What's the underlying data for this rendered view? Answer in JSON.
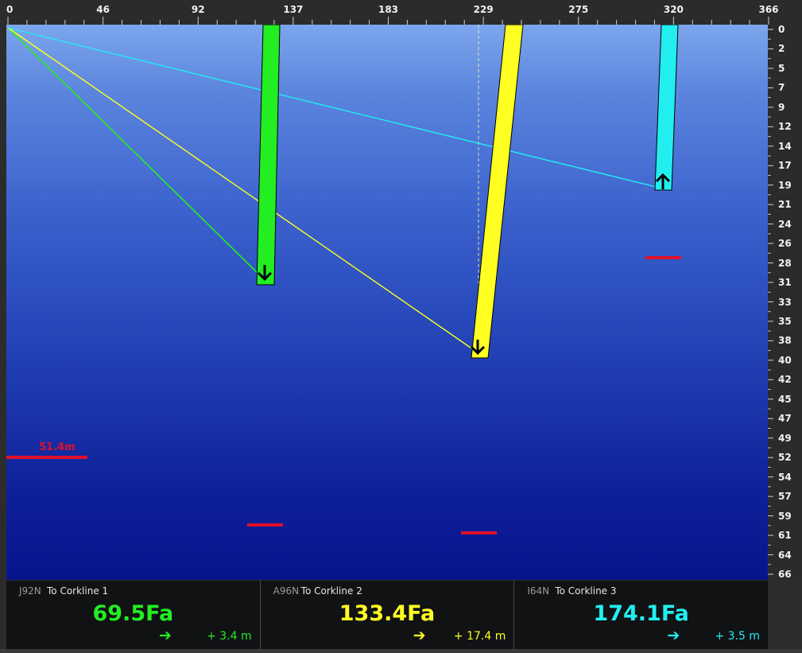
{
  "top_axis": {
    "labels": [
      "0",
      "46",
      "92",
      "137",
      "183",
      "229",
      "275",
      "320",
      "366"
    ]
  },
  "right_axis": {
    "labels": [
      "0",
      "2",
      "5",
      "7",
      "9",
      "12",
      "14",
      "17",
      "19",
      "21",
      "24",
      "26",
      "28",
      "31",
      "33",
      "35",
      "38",
      "40",
      "42",
      "45",
      "47",
      "49",
      "52",
      "54",
      "57",
      "59",
      "61",
      "64",
      "66"
    ]
  },
  "plot": {
    "depth_marker_label": "51.4m",
    "colors": {
      "green": "#22ee22",
      "yellow": "#ffff22",
      "cyan": "#22eef0",
      "marker_red": "#e0102a"
    }
  },
  "panels": [
    {
      "code": "J92N",
      "name": "To Corkline  1",
      "value": "69.5Fa",
      "arrow": "➔",
      "delta": "+ 3.4 m",
      "color": "#22ee22"
    },
    {
      "code": "A96N",
      "name": "To Corkline  2",
      "value": "133.4Fa",
      "arrow": "➔",
      "delta": "+ 17.4 m",
      "color": "#ffff22"
    },
    {
      "code": "I64N",
      "name": "To Corkline  3",
      "value": "174.1Fa",
      "arrow": "➔",
      "delta": "+ 3.5 m",
      "color": "#22eef0"
    }
  ]
}
